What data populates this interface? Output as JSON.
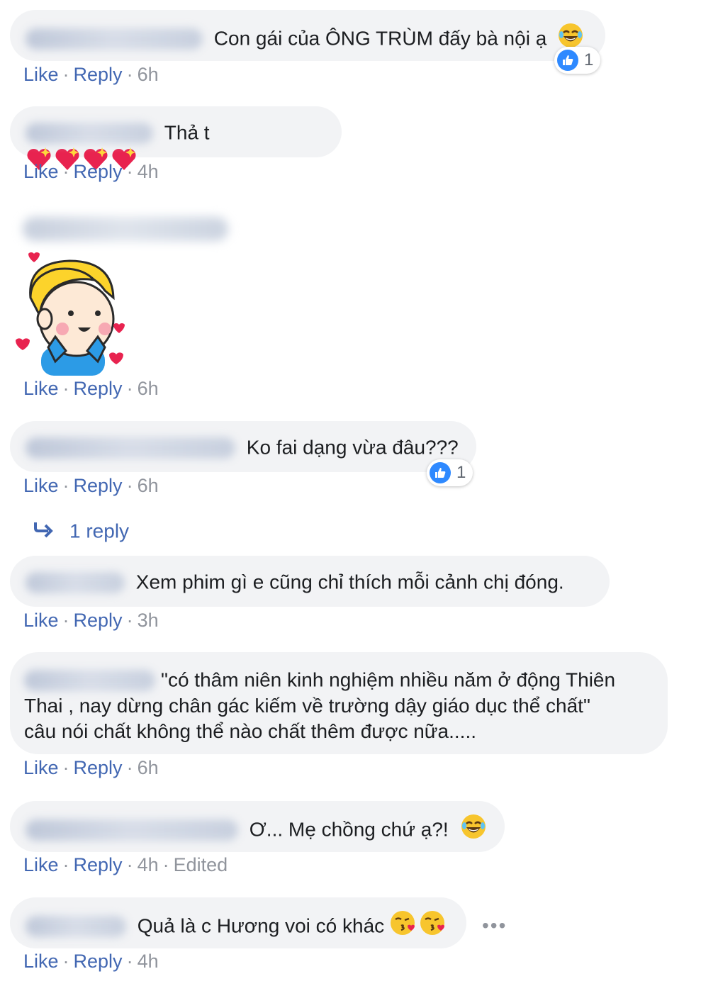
{
  "actions": {
    "like": "Like",
    "reply": "Reply",
    "sep": "·"
  },
  "comments": [
    {
      "text": "Con gái của ÔNG TRÙM đấy bà nội ạ",
      "time": "6h",
      "reaction_count": "1"
    },
    {
      "text": "Thả t",
      "time": "4h"
    },
    {
      "text": "",
      "time": "6h"
    },
    {
      "text": "Ko fai dạng vừa đâu???",
      "time": "6h",
      "reaction_count": "1",
      "replies_label": "1 reply"
    },
    {
      "text": "Xem phim gì e cũng chỉ thích mỗi cảnh chị đóng.",
      "time": "3h"
    },
    {
      "text_line1": "\"có thâm niên kinh nghiệm nhiều năm ở động Thiên",
      "text_line2": "Thai , nay dừng chân gác kiếm về trường dậy giáo dục thể chất\"",
      "text_line3": "câu nói chất không thể nào chất thêm được nữa.....",
      "time": "6h"
    },
    {
      "text": "Ơ... Mẹ chồng chứ ạ?!",
      "time": "4h",
      "edited": "Edited"
    },
    {
      "text": "Quả là c Hương voi có khác",
      "time": "4h",
      "more": "•••"
    }
  ],
  "colors": {
    "link": "#4267b2",
    "bubble": "#f2f3f5",
    "meta": "#90949c",
    "like_blue": "#2e89ff"
  }
}
